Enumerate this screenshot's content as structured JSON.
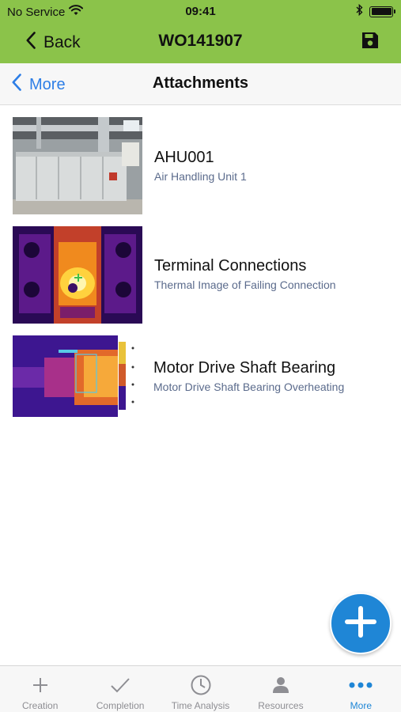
{
  "status": {
    "carrier": "No Service",
    "time": "09:41"
  },
  "nav": {
    "back_label": "Back",
    "title": "WO141907"
  },
  "subnav": {
    "back_label": "More",
    "title": "Attachments"
  },
  "attachments": [
    {
      "name": "AHU001",
      "description": "Air Handling Unit 1"
    },
    {
      "name": "Terminal Connections",
      "description": "Thermal Image of Failing Connection"
    },
    {
      "name": "Motor Drive Shaft Bearing",
      "description": "Motor Drive Shaft Bearing Overheating"
    }
  ],
  "tabs": [
    {
      "label": "Creation",
      "icon": "plus-icon"
    },
    {
      "label": "Completion",
      "icon": "checkmark-icon"
    },
    {
      "label": "Time Analysis",
      "icon": "clock-icon"
    },
    {
      "label": "Resources",
      "icon": "person-icon"
    },
    {
      "label": "More",
      "icon": "more-dots-icon",
      "active": true
    }
  ],
  "colors": {
    "header": "#8bc34a",
    "accent": "#1f86d6",
    "link": "#2d7ee6",
    "description": "#5b6b8c"
  }
}
